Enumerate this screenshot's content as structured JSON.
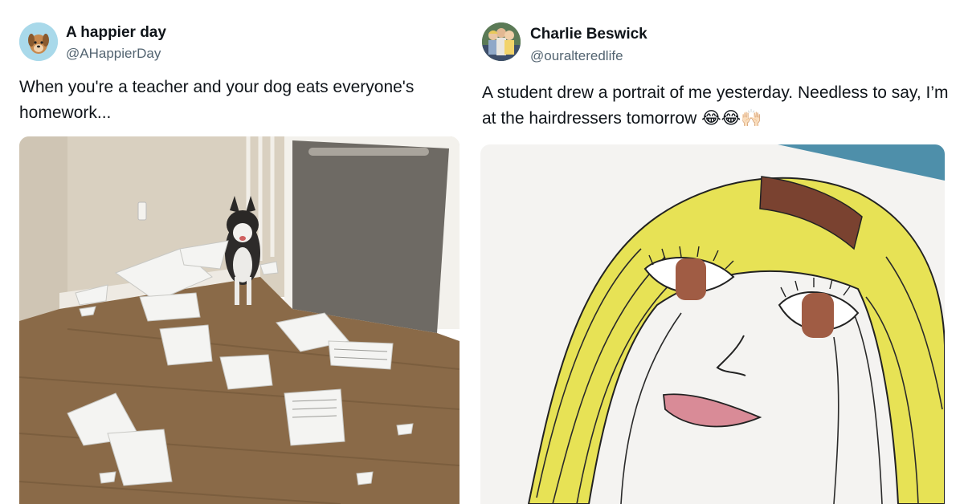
{
  "tweets": [
    {
      "display_name": "A happier day",
      "handle": "@AHappierDay",
      "text": "When you're a teacher and your dog eats everyone's homework...",
      "avatar_icon": "dog-avatar-icon",
      "media_icon": "dog-homework-photo"
    },
    {
      "display_name": "Charlie Beswick",
      "handle": "@ouralteredlife",
      "text": "A student drew a portrait of me yesterday. Needless to say, I’m at the hairdressers tomorrow 😂😂🙌🏻",
      "avatar_icon": "family-avatar-icon",
      "media_icon": "child-portrait-drawing"
    }
  ],
  "colors": {
    "text_primary": "#0f1419",
    "text_secondary": "#536471",
    "background": "#ffffff"
  }
}
